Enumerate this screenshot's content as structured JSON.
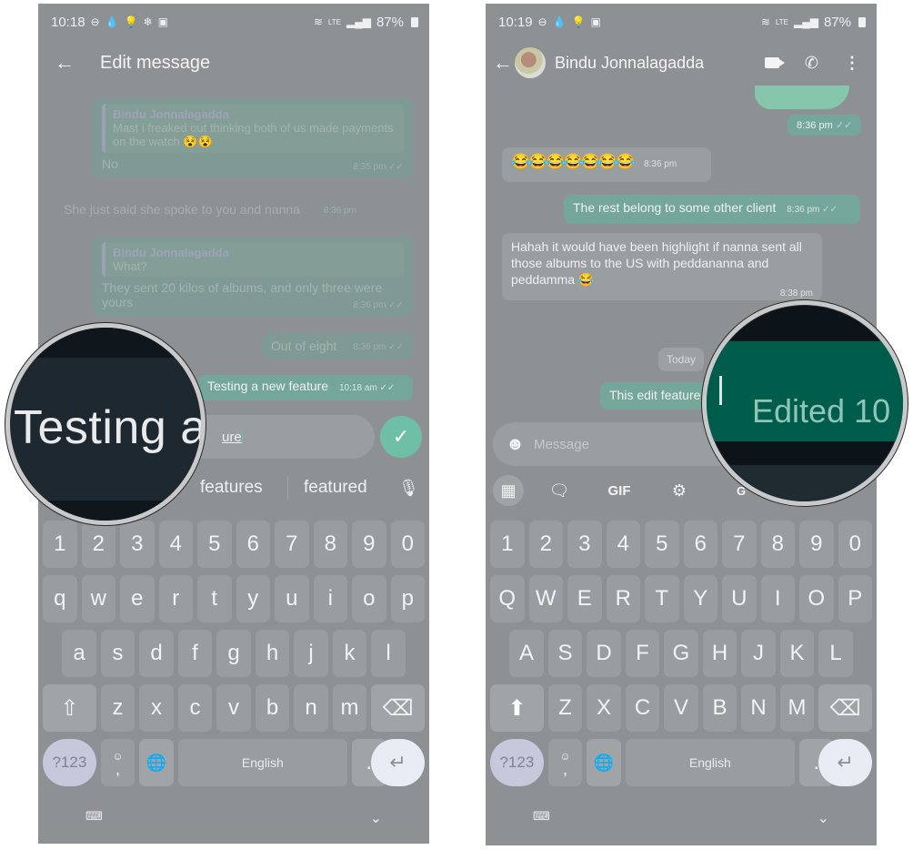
{
  "left_screen": {
    "status_bar": {
      "time": "10:18",
      "left_icons": [
        "do-not-disturb-icon",
        "water-drop-icon",
        "bulb-icon",
        "snowflake-icon",
        "image-icon"
      ],
      "right_icons": [
        "wifi-icon",
        "volte-lte-icon",
        "signal-icon"
      ],
      "battery": "87%"
    },
    "app_bar": {
      "title": "Edit message"
    },
    "messages": [
      {
        "direction": "out",
        "quote_author": "Bindu Jonnalagadda",
        "quote_text": "Mast i freaked out thinking both of us made payments on the watch 😵😵",
        "text": "No",
        "time": "8:35 pm",
        "read": true
      },
      {
        "direction": "in",
        "text": "She just said she spoke to you and nanna",
        "time": "8:36 pm"
      },
      {
        "direction": "out",
        "quote_author": "Bindu Jonnalagadda",
        "quote_text": "What?",
        "text": "They sent 20 kilos of albums, and only three were yours",
        "time": "8:36 pm",
        "read": true
      },
      {
        "direction": "out",
        "text": "Out of eight",
        "time": "8:36 pm",
        "read": true
      },
      {
        "direction": "out",
        "text": "Testing a new feature",
        "time": "10:18 am",
        "read": true,
        "highlighted": true
      }
    ],
    "composer": {
      "value_visible": "ure",
      "full_value": "Testing a new feature"
    },
    "send_button": {
      "icon": "check-icon"
    },
    "suggestions": [
      "features",
      "featured"
    ],
    "voice_icon": "mic-icon",
    "magnifier_text": "Testing a",
    "keyboard": {
      "row_numbers": [
        "1",
        "2",
        "3",
        "4",
        "5",
        "6",
        "7",
        "8",
        "9",
        "0"
      ],
      "row1": [
        "q",
        "w",
        "e",
        "r",
        "t",
        "y",
        "u",
        "i",
        "o",
        "p"
      ],
      "row2": [
        "a",
        "s",
        "d",
        "f",
        "g",
        "h",
        "j",
        "k",
        "l"
      ],
      "row3": [
        "z",
        "x",
        "c",
        "v",
        "b",
        "n",
        "m"
      ],
      "symbols_label": "?123",
      "comma_label": ",",
      "comma_emoji": "☺",
      "space_label": "English",
      "period_label": ".",
      "shift_icon": "⇧",
      "backspace_icon": "⌫",
      "enter_icon": "↵",
      "globe_icon": "🌐",
      "kb_switch_icon": "⌨",
      "hide_icon": "⌄"
    }
  },
  "right_screen": {
    "status_bar": {
      "time": "10:19",
      "left_icons": [
        "do-not-disturb-icon",
        "water-drop-icon",
        "bulb-icon",
        "image-icon"
      ],
      "right_icons": [
        "wifi-icon",
        "volte-lte-icon",
        "signal-icon"
      ],
      "battery": "87%"
    },
    "app_bar": {
      "contact_name": "Bindu Jonnalagadda"
    },
    "messages": [
      {
        "direction": "out",
        "type": "sticker",
        "time": "8:36 pm",
        "read": true
      },
      {
        "direction": "in",
        "text": "😂😂😂😂😂😂😂",
        "time": "8:36 pm"
      },
      {
        "direction": "out",
        "text": "The rest belong to some other client",
        "time": "8:36 pm",
        "read": true
      },
      {
        "direction": "in",
        "text": "Hahah it would have been highlight if nanna sent all those albums to the US with peddananna and peddamma 😂",
        "time": "8:38 pm"
      },
      {
        "direction": "out",
        "text": "This edit feature",
        "edited": true
      }
    ],
    "date_chip": "Today",
    "composer": {
      "placeholder": "Message"
    },
    "toolbar": [
      "apps-grid-icon",
      "sticker-icon",
      "GIF",
      "settings-icon",
      "translate-icon"
    ],
    "magnifier_text": "Edited 10",
    "keyboard": {
      "row_numbers": [
        "1",
        "2",
        "3",
        "4",
        "5",
        "6",
        "7",
        "8",
        "9",
        "0"
      ],
      "row1": [
        "Q",
        "W",
        "E",
        "R",
        "T",
        "Y",
        "U",
        "I",
        "O",
        "P"
      ],
      "row2": [
        "A",
        "S",
        "D",
        "F",
        "G",
        "H",
        "J",
        "K",
        "L"
      ],
      "row3": [
        "Z",
        "X",
        "C",
        "V",
        "B",
        "N",
        "M"
      ],
      "symbols_label": "?123",
      "comma_label": ",",
      "comma_emoji": "☺",
      "space_label": "English",
      "period_label": ".",
      "shift_icon": "⬆",
      "backspace_icon": "⌫",
      "enter_icon": "↵",
      "globe_icon": "🌐",
      "kb_switch_icon": "⌨",
      "hide_icon": "⌄"
    }
  }
}
